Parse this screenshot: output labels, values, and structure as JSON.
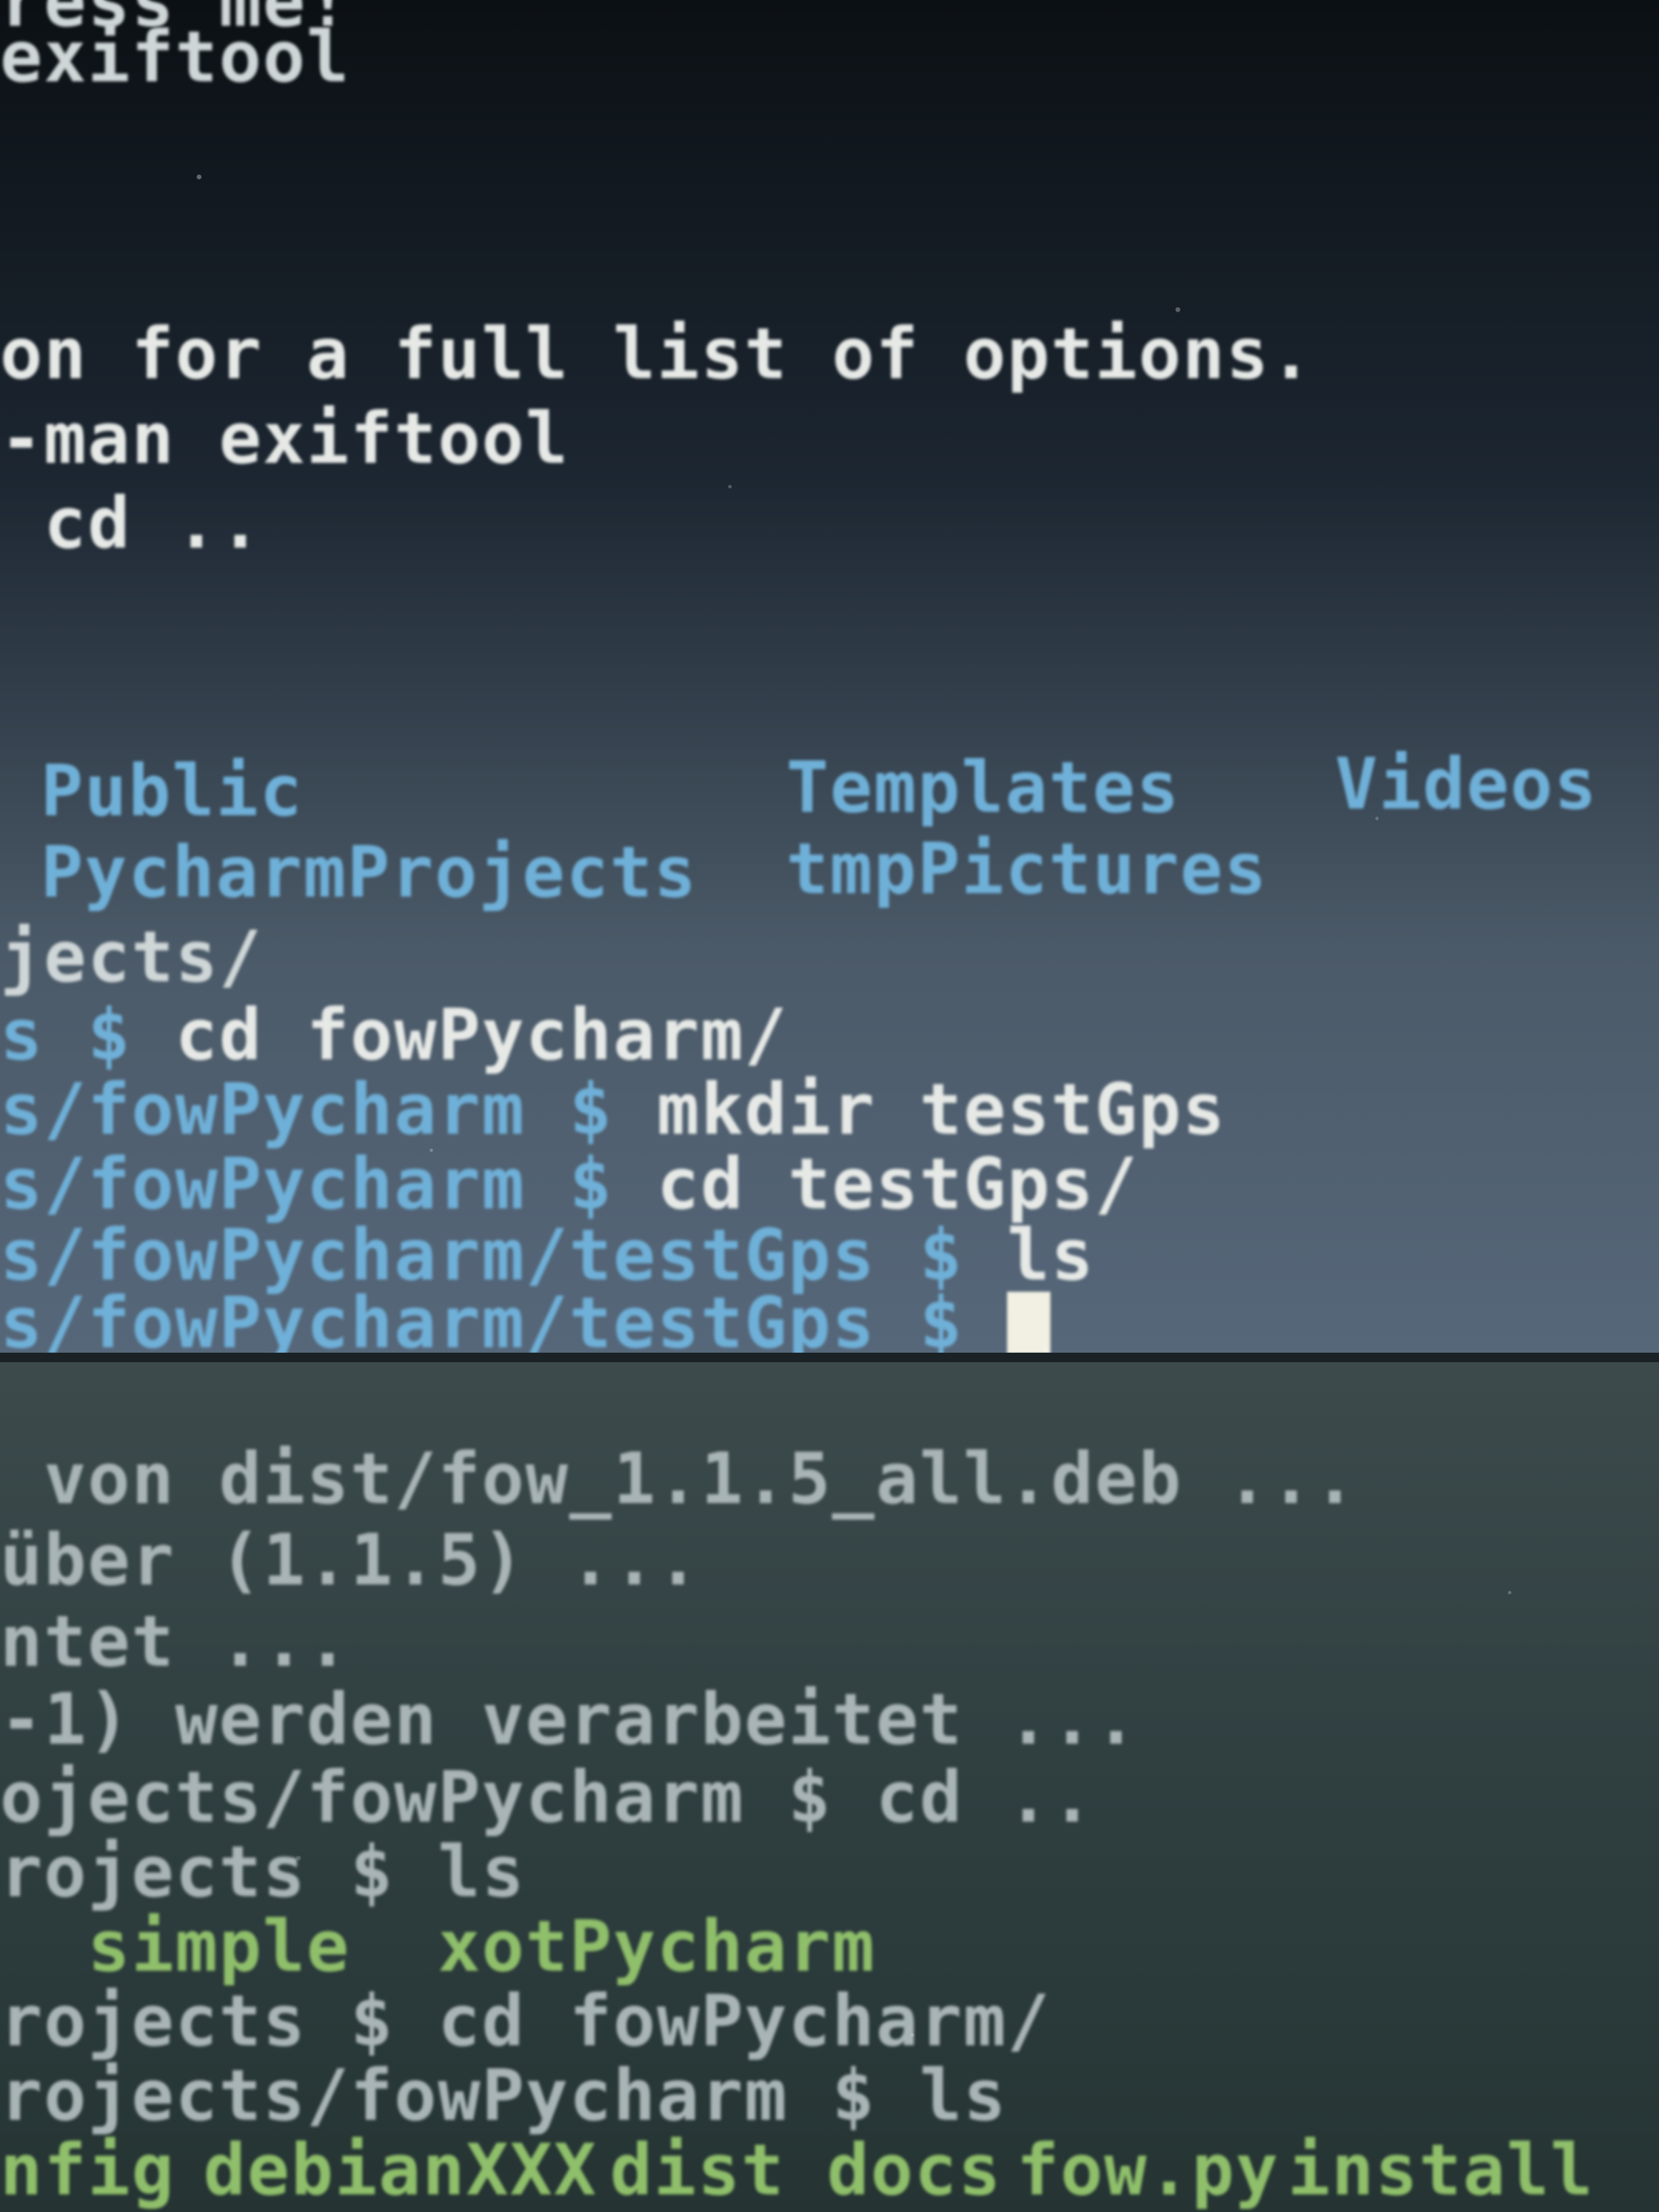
{
  "top_terminal": {
    "lines": [
      "ress me!",
      "exiftool",
      "on for a full list of options.",
      "-man exiftool",
      " cd .."
    ],
    "ls_row1": [
      "Public",
      "Templates",
      "Videos"
    ],
    "ls_row2": [
      "PycharmProjects",
      "tmpPictures"
    ],
    "prompt_lines": [
      {
        "path": "jects/",
        "cmd": ""
      },
      {
        "path": "s $ ",
        "cmd": "cd fowPycharm/"
      },
      {
        "path": "s/fowPycharm $ ",
        "cmd": "mkdir testGps"
      },
      {
        "path": "s/fowPycharm $ ",
        "cmd": "cd testGps/"
      },
      {
        "path": "s/fowPycharm/testGps $ ",
        "cmd": "ls"
      },
      {
        "path": "s/fowPycharm/testGps $ ",
        "cmd": ""
      }
    ]
  },
  "bottom_terminal": {
    "lines": [
      " von dist/fow_1.1.5_all.deb ...",
      "über (1.1.5) ...",
      "ntet ...",
      "-1) werden verarbeitet ...",
      "ojects/fowPycharm $ cd ..",
      "rojects $ ls",
      "  simple  xotPycharm",
      "rojects $ cd fowPycharm/",
      "rojects/fowPycharm $ ls"
    ],
    "last_row": [
      "nfig",
      "debianXXX",
      "dist",
      "docs",
      "fow.py",
      "install"
    ]
  },
  "colors": {
    "directory": "#6fb0d8",
    "text": "#e6e9e6",
    "cursor": "#f2f0e2"
  }
}
